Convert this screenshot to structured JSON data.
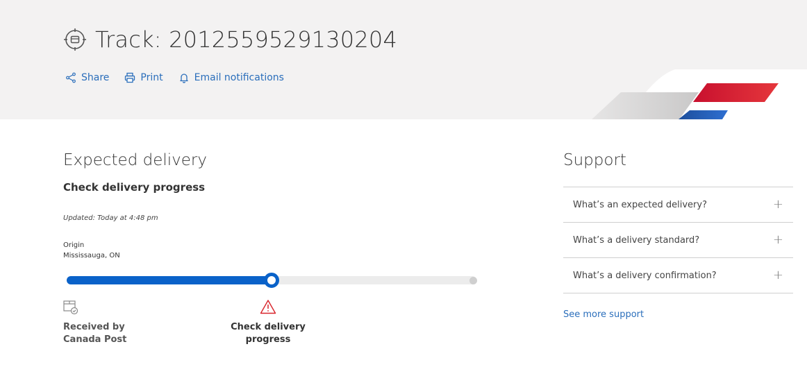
{
  "header": {
    "title": "Track: 2012559529130204",
    "actions": [
      {
        "label": "Share",
        "icon": "share-icon"
      },
      {
        "label": "Print",
        "icon": "printer-icon"
      },
      {
        "label": "Email notifications",
        "icon": "bell-icon"
      }
    ]
  },
  "delivery": {
    "heading": "Expected delivery",
    "status": "Check delivery progress",
    "updated": "Updated: Today at 4:48 pm",
    "origin_label": "Origin",
    "origin_value": "Mississauga, ON",
    "progress_fraction": 0.5,
    "steps": [
      {
        "line1": "Received by",
        "line2": "Canada Post",
        "icon": "package-received-icon"
      },
      {
        "line1": "Check delivery",
        "line2": "progress",
        "icon": "warning-icon"
      }
    ]
  },
  "support": {
    "heading": "Support",
    "items": [
      {
        "question": "What’s an expected delivery?",
        "expand": "+"
      },
      {
        "question": "What’s a delivery standard?",
        "expand": "+"
      },
      {
        "question": "What’s a delivery confirmation?",
        "expand": "+"
      }
    ],
    "see_more": "See more support"
  },
  "colors": {
    "accent_blue": "#2a6ebb",
    "progress_blue": "#0a62c9",
    "brand_red": "#d8232a",
    "warning_red": "#d8232a"
  }
}
